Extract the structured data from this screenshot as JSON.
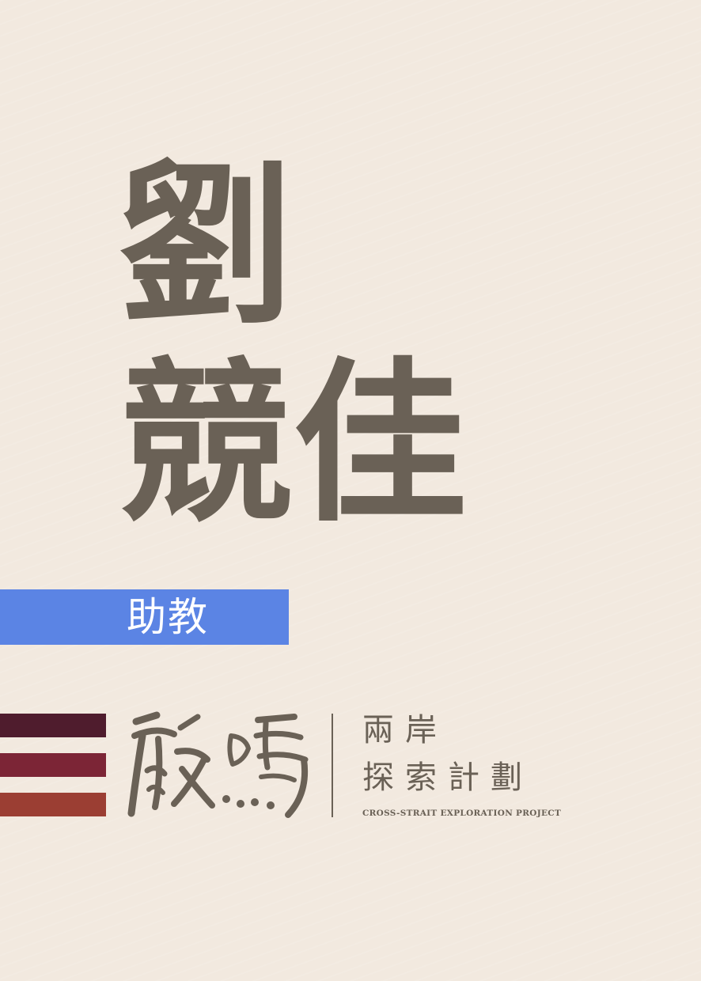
{
  "person": {
    "name_line1": "劉",
    "name_line2": "競佳",
    "role": "助教"
  },
  "logo": {
    "brush_text": "啟鳴",
    "line1": "兩岸",
    "line2": "探索計劃",
    "english": "CROSS-STRAIT EXPLORATION PROJECT"
  },
  "colors": {
    "background": "#f2e9df",
    "text": "#6a6156",
    "role_bar": "#5b84e4",
    "stripe_top": "#4f1c2d",
    "stripe_middle": "#7c2536",
    "stripe_bottom": "#9b3e33"
  }
}
